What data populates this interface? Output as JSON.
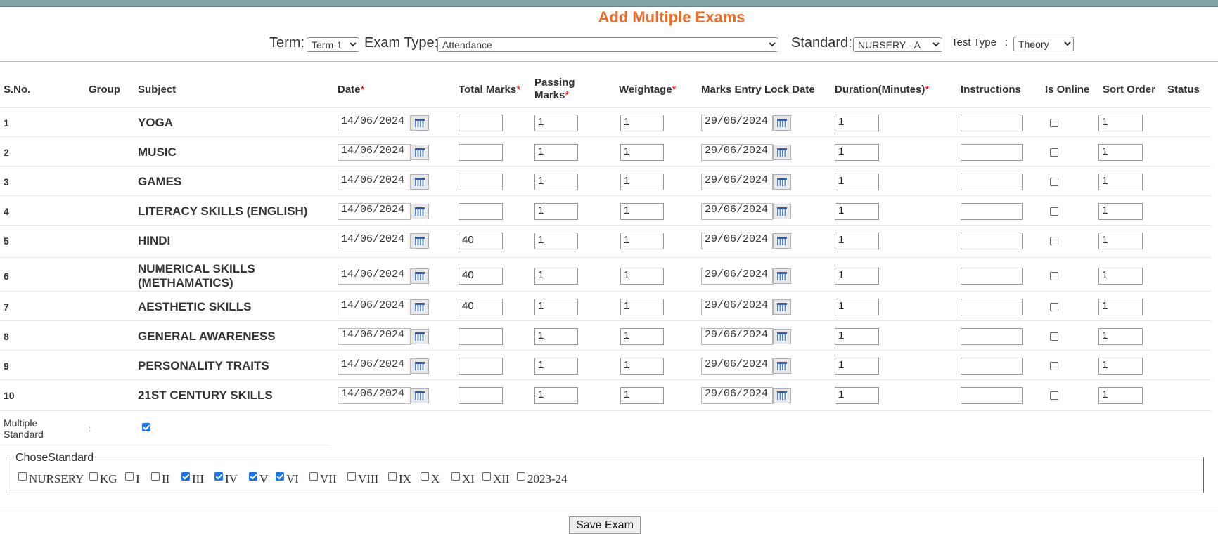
{
  "page": {
    "title": "Add Multiple Exams"
  },
  "filters": {
    "term_label": "Term:",
    "term_value": "Term-1",
    "exam_type_label": "Exam Type:",
    "exam_type_value": "Attendance",
    "standard_label": "Standard:",
    "standard_value": "NURSERY - A",
    "test_type_label": "Test Type",
    "test_type_colon": ":",
    "test_type_value": "Theory"
  },
  "columns": {
    "sno": "S.No.",
    "group": "Group",
    "subject": "Subject",
    "date": "Date",
    "total_marks": "Total Marks",
    "passing_marks_1": "Passing",
    "passing_marks_2": "Marks",
    "weightage": "Weightage",
    "lock_date": "Marks Entry Lock Date",
    "duration": "Duration(Minutes)",
    "instructions": "Instructions",
    "is_online": "Is Online",
    "sort_order": "Sort Order",
    "status": "Status",
    "required_mark": "*"
  },
  "rows": [
    {
      "sno": "1",
      "subject": "YOGA",
      "date": "14/06/2024",
      "total_marks": "",
      "passing_marks": "1",
      "weightage": "1",
      "lock_date": "29/06/2024",
      "duration": "1",
      "instructions": "",
      "is_online": false,
      "sort_order": "1"
    },
    {
      "sno": "2",
      "subject": "MUSIC",
      "date": "14/06/2024",
      "total_marks": "",
      "passing_marks": "1",
      "weightage": "1",
      "lock_date": "29/06/2024",
      "duration": "1",
      "instructions": "",
      "is_online": false,
      "sort_order": "1"
    },
    {
      "sno": "3",
      "subject": "GAMES",
      "date": "14/06/2024",
      "total_marks": "",
      "passing_marks": "1",
      "weightage": "1",
      "lock_date": "29/06/2024",
      "duration": "1",
      "instructions": "",
      "is_online": false,
      "sort_order": "1"
    },
    {
      "sno": "4",
      "subject": "LITERACY SKILLS (ENGLISH)",
      "date": "14/06/2024",
      "total_marks": "",
      "passing_marks": "1",
      "weightage": "1",
      "lock_date": "29/06/2024",
      "duration": "1",
      "instructions": "",
      "is_online": false,
      "sort_order": "1"
    },
    {
      "sno": "5",
      "subject": "HINDI",
      "date": "14/06/2024",
      "total_marks": "40",
      "passing_marks": "1",
      "weightage": "1",
      "lock_date": "29/06/2024",
      "duration": "1",
      "instructions": "",
      "is_online": false,
      "sort_order": "1"
    },
    {
      "sno": "6",
      "subject": "NUMERICAL SKILLS (METHAMATICS)",
      "date": "14/06/2024",
      "total_marks": "40",
      "passing_marks": "1",
      "weightage": "1",
      "lock_date": "29/06/2024",
      "duration": "1",
      "instructions": "",
      "is_online": false,
      "sort_order": "1"
    },
    {
      "sno": "7",
      "subject": "AESTHETIC SKILLS",
      "date": "14/06/2024",
      "total_marks": "40",
      "passing_marks": "1",
      "weightage": "1",
      "lock_date": "29/06/2024",
      "duration": "1",
      "instructions": "",
      "is_online": false,
      "sort_order": "1"
    },
    {
      "sno": "8",
      "subject": "GENERAL AWARENESS",
      "date": "14/06/2024",
      "total_marks": "",
      "passing_marks": "1",
      "weightage": "1",
      "lock_date": "29/06/2024",
      "duration": "1",
      "instructions": "",
      "is_online": false,
      "sort_order": "1"
    },
    {
      "sno": "9",
      "subject": "PERSONALITY TRAITS",
      "date": "14/06/2024",
      "total_marks": "",
      "passing_marks": "1",
      "weightage": "1",
      "lock_date": "29/06/2024",
      "duration": "1",
      "instructions": "",
      "is_online": false,
      "sort_order": "1"
    },
    {
      "sno": "10",
      "subject": "21ST CENTURY SKILLS",
      "date": "14/06/2024",
      "total_marks": "",
      "passing_marks": "1",
      "weightage": "1",
      "lock_date": "29/06/2024",
      "duration": "1",
      "instructions": "",
      "is_online": false,
      "sort_order": "1"
    }
  ],
  "multiple_standard": {
    "label_1": "Multiple",
    "label_2": "Standard",
    "colon": ":",
    "checked": true
  },
  "chose_standard": {
    "legend": "ChoseStandard",
    "options": [
      {
        "label": "NURSERY",
        "checked": false
      },
      {
        "label": "KG",
        "checked": false
      },
      {
        "label": "I",
        "checked": false
      },
      {
        "label": "II",
        "checked": false
      },
      {
        "label": "III",
        "checked": true
      },
      {
        "label": "IV",
        "checked": true
      },
      {
        "label": "V",
        "checked": true
      },
      {
        "label": "VI",
        "checked": true
      },
      {
        "label": "VII",
        "checked": false
      },
      {
        "label": "VIII",
        "checked": false
      },
      {
        "label": "IX",
        "checked": false
      },
      {
        "label": "X",
        "checked": false
      },
      {
        "label": "XI",
        "checked": false
      },
      {
        "label": "XII",
        "checked": false
      },
      {
        "label": "2023-24",
        "checked": false
      }
    ]
  },
  "actions": {
    "save_label": "Save Exam"
  },
  "colors": {
    "title": "#f26b21",
    "required": "#e00000",
    "top_bar": "#7fa6a6",
    "checkbox_on": "#1a73e8"
  }
}
